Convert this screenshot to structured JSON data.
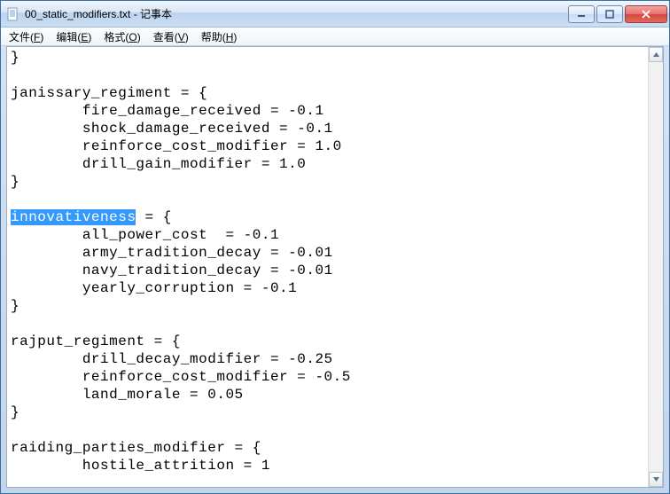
{
  "window": {
    "title": "00_static_modifiers.txt - 记事本"
  },
  "menu": {
    "file": "文件(F)",
    "edit": "编辑(E)",
    "format": "格式(O)",
    "view": "查看(V)",
    "help": "帮助(H)"
  },
  "editor": {
    "selection": "innovativeness",
    "before": "}\n\njanissary_regiment = {\n        fire_damage_received = -0.1\n        shock_damage_received = -0.1\n        reinforce_cost_modifier = 1.0\n        drill_gain_modifier = 1.0\n}\n\n",
    "after": " = {\n        all_power_cost  = -0.1\n        army_tradition_decay = -0.01\n        navy_tradition_decay = -0.01\n        yearly_corruption = -0.1\n}\n\nrajput_regiment = {\n        drill_decay_modifier = -0.25\n        reinforce_cost_modifier = -0.5\n        land_morale = 0.05\n}\n\nraiding_parties_modifier = {\n        hostile_attrition = 1"
  }
}
